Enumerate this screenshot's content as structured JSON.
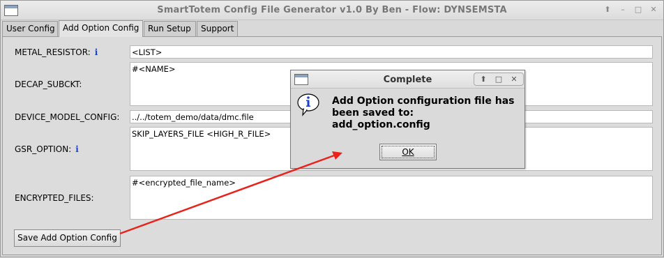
{
  "window": {
    "title": "SmartTotem Config File Generator v1.0 By Ben - Flow: DYNSEMSTA",
    "controls": [
      "⬆",
      "–",
      "□",
      "✕"
    ]
  },
  "tabs": [
    {
      "label": "User Config",
      "active": false
    },
    {
      "label": "Add Option Config",
      "active": true
    },
    {
      "label": "Run Setup",
      "active": false
    },
    {
      "label": "Support",
      "active": false
    }
  ],
  "form": {
    "metal_resistor": {
      "label": "METAL_RESISTOR:",
      "info": "i",
      "value": "<LIST>"
    },
    "decap_subckt": {
      "label": "DECAP_SUBCKT:",
      "value": "#<NAME>"
    },
    "device_model_config": {
      "label": "DEVICE_MODEL_CONFIG:",
      "value": "../../totem_demo/data/dmc.file"
    },
    "gsr_option": {
      "label": "GSR_OPTION:",
      "info": "i",
      "value": "SKIP_LAYERS_FILE <HIGH_R_FILE>"
    },
    "encrypted_files": {
      "label": "ENCRYPTED_FILES:",
      "value": "#<encrypted_file_name>"
    },
    "save_button": "Save Add Option Config"
  },
  "dialog": {
    "title": "Complete",
    "icon": "info-icon",
    "message_line1": "Add Option configuration file has",
    "message_line2": "been saved to:",
    "message_line3": "add_option.config",
    "ok_button": "OK"
  },
  "annotation": {
    "arrow_color": "#e8231c"
  }
}
